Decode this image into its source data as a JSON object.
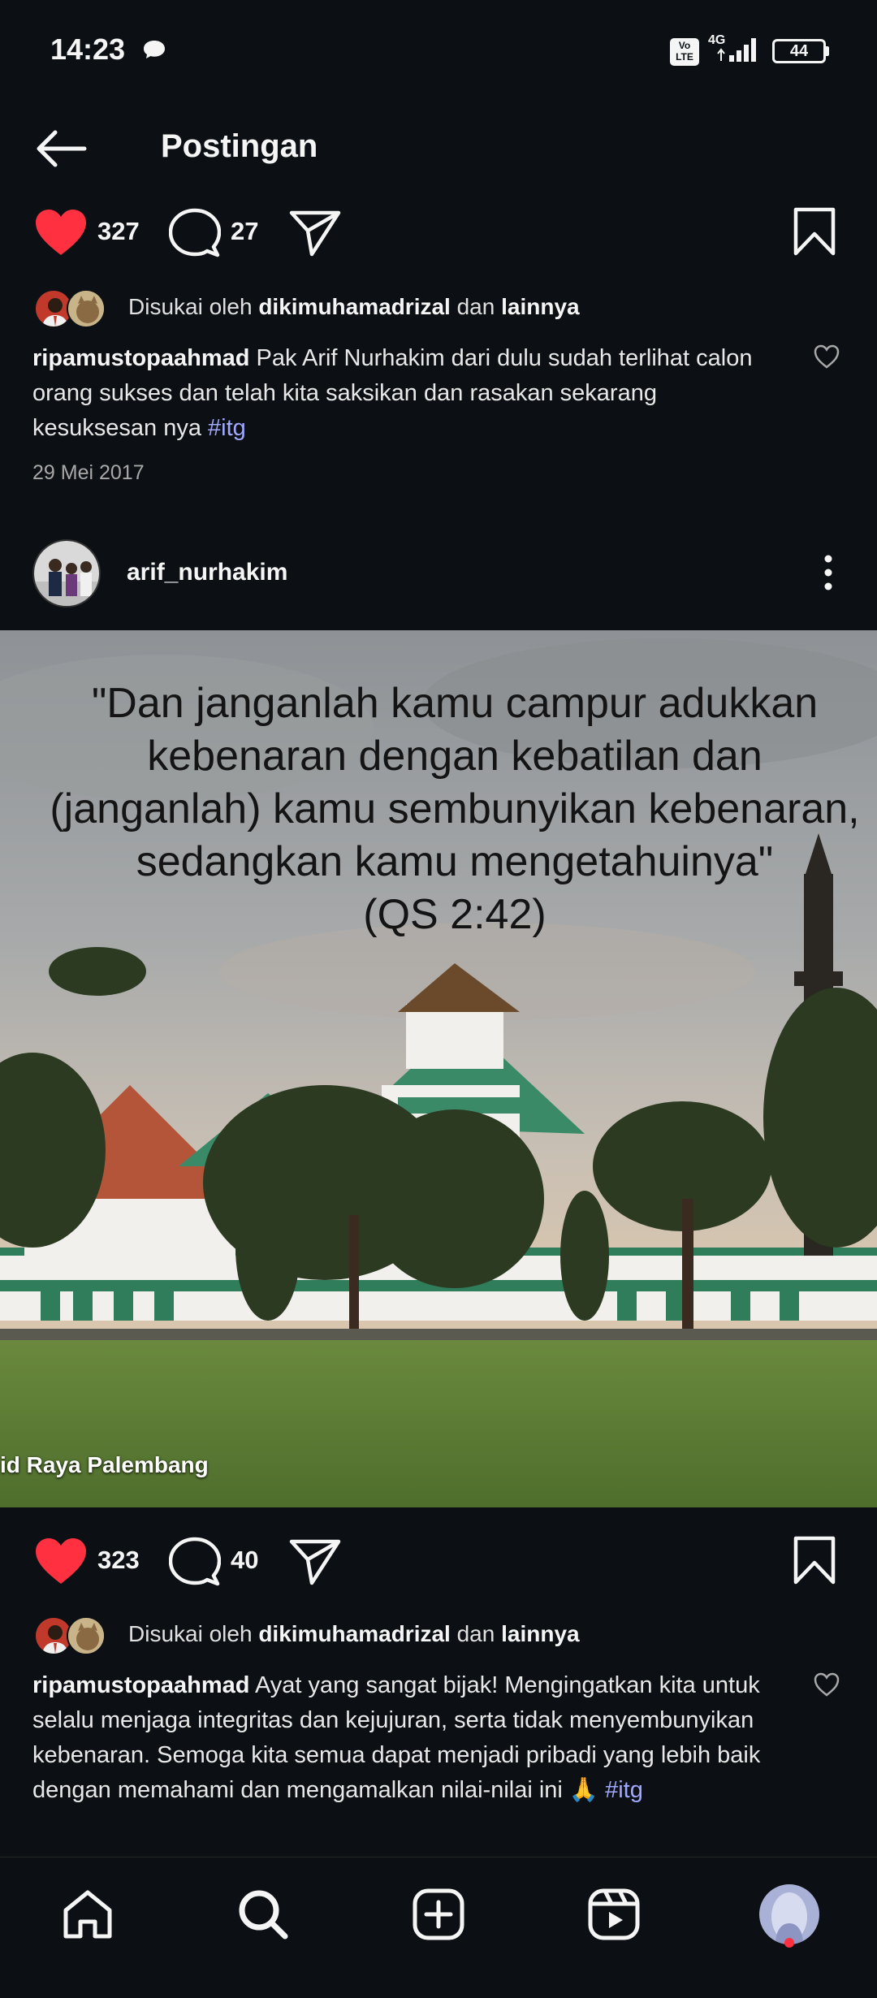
{
  "status_bar": {
    "time": "14:23",
    "volte": "Vo\nLTE",
    "network": "4G",
    "battery": "44",
    "icons": [
      "chat-bubble-icon",
      "volte-icon",
      "signal-icon",
      "battery-icon"
    ]
  },
  "header": {
    "title": "Postingan",
    "back_icon": "arrow-left-icon"
  },
  "post1": {
    "likes": "327",
    "comments": "27",
    "liked_by_prefix": "Disukai oleh",
    "liked_by_user": "dikimuhamadrizal",
    "liked_by_and": "dan",
    "liked_by_others": "lainnya",
    "caption_user": "ripamustopaahmad",
    "caption_text": " Pak Arif Nurhakim dari dulu sudah terlihat calon orang sukses dan telah kita saksikan dan rasakan sekarang kesuksesan nya ",
    "caption_hashtag": "#itg",
    "date": "29 Mei 2017"
  },
  "post2": {
    "author": "arif_nurhakim",
    "quote": "\"Dan janganlah kamu campur adukkan\nkebenaran dengan kebatilan dan\n(janganlah) kamu sembunyikan kebenaran,\nsedangkan kamu mengetahuinya\"\n(QS 2:42)",
    "watermark": "id Raya Palembang",
    "likes": "323",
    "comments": "40",
    "liked_by_prefix": "Disukai oleh",
    "liked_by_user": "dikimuhamadrizal",
    "liked_by_and": "dan",
    "liked_by_others": "lainnya",
    "caption_user": "ripamustopaahmad",
    "caption_text": " Ayat yang sangat bijak! Mengingatkan kita untuk selalu menjaga integritas dan kejujuran, serta tidak menyembunyikan kebenaran. Semoga kita semua dapat menjadi pribadi yang lebih baik dengan memahami dan mengamalkan nilai-nilai ini 🙏",
    "caption_hashtag": "#itg"
  },
  "colors": {
    "background": "#0c1014",
    "like_red": "#ff3040",
    "hashtag": "#a0a8ff",
    "secondary_text": "#a8a8a8"
  },
  "bottom_nav": {
    "items": [
      "home-icon",
      "search-icon",
      "create-icon",
      "reels-icon",
      "profile-avatar"
    ]
  }
}
